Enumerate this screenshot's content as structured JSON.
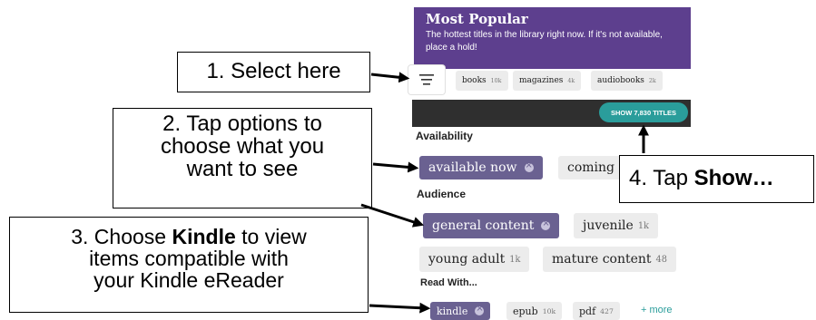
{
  "banner": {
    "title": "Most Popular",
    "subtitle": "The hottest titles in the library right now. If it's not available, place a hold!"
  },
  "media_filters": [
    {
      "label": "books",
      "count": "10k"
    },
    {
      "label": "magazines",
      "count": "4k"
    },
    {
      "label": "audiobooks",
      "count": "2k"
    }
  ],
  "show_button": "SHOW 7,830 TITLES",
  "availability": {
    "heading": "Availability",
    "options": [
      {
        "label": "available now",
        "selected": true
      },
      {
        "label": "coming",
        "selected": false
      }
    ]
  },
  "audience": {
    "heading": "Audience",
    "options": [
      {
        "label": "general content",
        "count": "",
        "selected": true
      },
      {
        "label": "juvenile",
        "count": "1k",
        "selected": false
      },
      {
        "label": "young adult",
        "count": "1k",
        "selected": false
      },
      {
        "label": "mature content",
        "count": "48",
        "selected": false
      }
    ]
  },
  "read_with": {
    "heading": "Read With...",
    "options": [
      {
        "label": "kindle",
        "count": "",
        "selected": true
      },
      {
        "label": "epub",
        "count": "10k",
        "selected": false
      },
      {
        "label": "pdf",
        "count": "427",
        "selected": false
      }
    ],
    "more": "+ more"
  },
  "callouts": {
    "step1": "1. Select here",
    "step2_lines": [
      "2. Tap options to",
      "choose what you",
      "want to see"
    ],
    "step3_line1_pre": "3. Choose ",
    "step3_line1_bold": "Kindle",
    "step3_line1_post": " to view",
    "step3_line2": "items compatible with",
    "step3_line3": "your Kindle eReader",
    "step4_pre": "4. Tap ",
    "step4_bold": "Show…"
  },
  "colors": {
    "banner": "#5d3f8e",
    "selected_pill": "#6a6191",
    "show_button": "#2a9d9b",
    "dark_bar": "#2f2f2f"
  }
}
